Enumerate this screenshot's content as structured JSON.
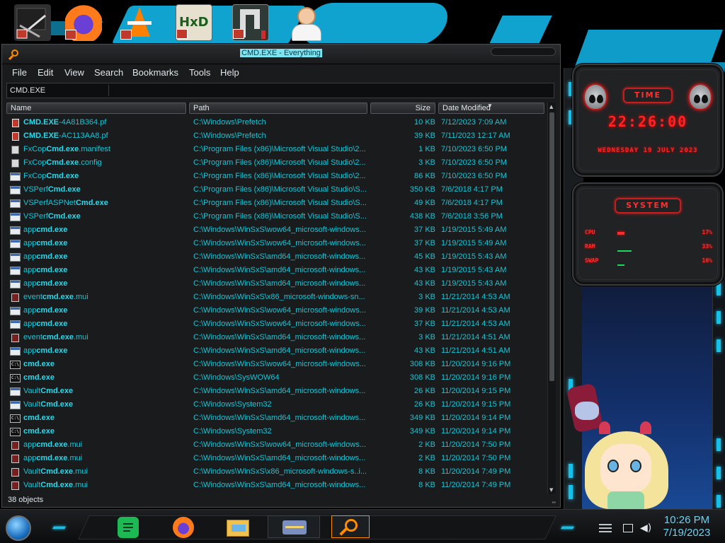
{
  "desktop": {
    "icons": [
      {
        "name": "Manage tools",
        "icon": "tools-icon"
      },
      {
        "name": "Firefox",
        "icon": "firefox-icon"
      },
      {
        "name": "VLC",
        "icon": "vlc-icon"
      },
      {
        "name": "HxD",
        "icon": "hxd-icon",
        "text": "HxD"
      },
      {
        "name": "Launcher",
        "icon": "launcher-icon"
      },
      {
        "name": "Doctor",
        "icon": "doctor-icon"
      }
    ]
  },
  "widgets": {
    "time": {
      "badge": "TIME",
      "clock": "22:26:00",
      "date": "WEDNESDAY 19 JULY 2023"
    },
    "system": {
      "badge": "SYSTEM",
      "stats": [
        {
          "label": "CPU",
          "value": "17%",
          "level": 0.17
        },
        {
          "label": "RAM",
          "value": "33%",
          "level": 0.33
        },
        {
          "label": "SWAP",
          "value": "16%",
          "level": 0.16
        }
      ]
    }
  },
  "window": {
    "title": "CMD.EXE - Everything",
    "menu": [
      "File",
      "Edit",
      "View",
      "Search",
      "Bookmarks",
      "Tools",
      "Help"
    ],
    "search": {
      "value": "CMD.EXE",
      "placeholder": ""
    },
    "columns": {
      "name": "Name",
      "path": "Path",
      "size": "Size",
      "date": "Date Modified"
    },
    "rows": [
      {
        "icon": "pf",
        "pre": "",
        "match": "CMD.EXE",
        "post": "-4A81B364.pf",
        "path": "C:\\Windows\\Prefetch",
        "size": "10 KB",
        "date": "7/12/2023 7:09 AM"
      },
      {
        "icon": "pf",
        "pre": "",
        "match": "CMD.EXE",
        "post": "-AC113AA8.pf",
        "path": "C:\\Windows\\Prefetch",
        "size": "39 KB",
        "date": "7/11/2023 12:17 AM"
      },
      {
        "icon": "doc",
        "pre": "FxCop",
        "match": "Cmd.exe",
        "post": ".manifest",
        "path": "C:\\Program Files (x86)\\Microsoft Visual Studio\\2...",
        "size": "1 KB",
        "date": "7/10/2023 6:50 PM"
      },
      {
        "icon": "doc",
        "pre": "FxCop",
        "match": "Cmd.exe",
        "post": ".config",
        "path": "C:\\Program Files (x86)\\Microsoft Visual Studio\\2...",
        "size": "3 KB",
        "date": "7/10/2023 6:50 PM"
      },
      {
        "icon": "exe",
        "pre": "FxCop",
        "match": "Cmd.exe",
        "post": "",
        "path": "C:\\Program Files (x86)\\Microsoft Visual Studio\\2...",
        "size": "86 KB",
        "date": "7/10/2023 6:50 PM"
      },
      {
        "icon": "exe",
        "pre": "VSPerf",
        "match": "Cmd.exe",
        "post": "",
        "path": "C:\\Program Files (x86)\\Microsoft Visual Studio\\S...",
        "size": "350 KB",
        "date": "7/6/2018 4:17 PM"
      },
      {
        "icon": "exe",
        "pre": "VSPerfASPNet",
        "match": "Cmd.exe",
        "post": "",
        "path": "C:\\Program Files (x86)\\Microsoft Visual Studio\\S...",
        "size": "49 KB",
        "date": "7/6/2018 4:17 PM"
      },
      {
        "icon": "exe",
        "pre": "VSPerf",
        "match": "Cmd.exe",
        "post": "",
        "path": "C:\\Program Files (x86)\\Microsoft Visual Studio\\S...",
        "size": "438 KB",
        "date": "7/6/2018 3:56 PM"
      },
      {
        "icon": "exe",
        "pre": "app",
        "match": "cmd.exe",
        "post": "",
        "path": "C:\\Windows\\WinSxS\\wow64_microsoft-windows...",
        "size": "37 KB",
        "date": "1/19/2015 5:49 AM"
      },
      {
        "icon": "exe",
        "pre": "app",
        "match": "cmd.exe",
        "post": "",
        "path": "C:\\Windows\\WinSxS\\wow64_microsoft-windows...",
        "size": "37 KB",
        "date": "1/19/2015 5:49 AM"
      },
      {
        "icon": "exe",
        "pre": "app",
        "match": "cmd.exe",
        "post": "",
        "path": "C:\\Windows\\WinSxS\\amd64_microsoft-windows...",
        "size": "45 KB",
        "date": "1/19/2015 5:43 AM"
      },
      {
        "icon": "exe",
        "pre": "app",
        "match": "cmd.exe",
        "post": "",
        "path": "C:\\Windows\\WinSxS\\amd64_microsoft-windows...",
        "size": "43 KB",
        "date": "1/19/2015 5:43 AM"
      },
      {
        "icon": "exe",
        "pre": "app",
        "match": "cmd.exe",
        "post": "",
        "path": "C:\\Windows\\WinSxS\\amd64_microsoft-windows...",
        "size": "43 KB",
        "date": "1/19/2015 5:43 AM"
      },
      {
        "icon": "mui",
        "pre": "event",
        "match": "cmd.exe",
        "post": ".mui",
        "path": "C:\\Windows\\WinSxS\\x86_microsoft-windows-sn...",
        "size": "3 KB",
        "date": "11/21/2014 4:53 AM"
      },
      {
        "icon": "exe",
        "pre": "app",
        "match": "cmd.exe",
        "post": "",
        "path": "C:\\Windows\\WinSxS\\wow64_microsoft-windows...",
        "size": "39 KB",
        "date": "11/21/2014 4:53 AM"
      },
      {
        "icon": "exe",
        "pre": "app",
        "match": "cmd.exe",
        "post": "",
        "path": "C:\\Windows\\WinSxS\\wow64_microsoft-windows...",
        "size": "37 KB",
        "date": "11/21/2014 4:53 AM"
      },
      {
        "icon": "mui",
        "pre": "event",
        "match": "cmd.exe",
        "post": ".mui",
        "path": "C:\\Windows\\WinSxS\\amd64_microsoft-windows...",
        "size": "3 KB",
        "date": "11/21/2014 4:51 AM"
      },
      {
        "icon": "exe",
        "pre": "app",
        "match": "cmd.exe",
        "post": "",
        "path": "C:\\Windows\\WinSxS\\amd64_microsoft-windows...",
        "size": "43 KB",
        "date": "11/21/2014 4:51 AM"
      },
      {
        "icon": "cmd",
        "pre": "",
        "match": "cmd.exe",
        "post": "",
        "path": "C:\\Windows\\WinSxS\\wow64_microsoft-windows...",
        "size": "308 KB",
        "date": "11/20/2014 9:16 PM"
      },
      {
        "icon": "cmd",
        "pre": "",
        "match": "cmd.exe",
        "post": "",
        "path": "C:\\Windows\\SysWOW64",
        "size": "308 KB",
        "date": "11/20/2014 9:16 PM"
      },
      {
        "icon": "exe",
        "pre": "Vault",
        "match": "Cmd.exe",
        "post": "",
        "path": "C:\\Windows\\WinSxS\\amd64_microsoft-windows...",
        "size": "26 KB",
        "date": "11/20/2014 9:15 PM"
      },
      {
        "icon": "exe",
        "pre": "Vault",
        "match": "Cmd.exe",
        "post": "",
        "path": "C:\\Windows\\System32",
        "size": "26 KB",
        "date": "11/20/2014 9:15 PM"
      },
      {
        "icon": "cmd",
        "pre": "",
        "match": "cmd.exe",
        "post": "",
        "path": "C:\\Windows\\WinSxS\\amd64_microsoft-windows...",
        "size": "349 KB",
        "date": "11/20/2014 9:14 PM"
      },
      {
        "icon": "cmd",
        "pre": "",
        "match": "cmd.exe",
        "post": "",
        "path": "C:\\Windows\\System32",
        "size": "349 KB",
        "date": "11/20/2014 9:14 PM"
      },
      {
        "icon": "mui",
        "pre": "app",
        "match": "cmd.exe",
        "post": ".mui",
        "path": "C:\\Windows\\WinSxS\\wow64_microsoft-windows...",
        "size": "2 KB",
        "date": "11/20/2014 7:50 PM"
      },
      {
        "icon": "mui",
        "pre": "app",
        "match": "cmd.exe",
        "post": ".mui",
        "path": "C:\\Windows\\WinSxS\\amd64_microsoft-windows...",
        "size": "2 KB",
        "date": "11/20/2014 7:50 PM"
      },
      {
        "icon": "mui",
        "pre": "Vault",
        "match": "Cmd.exe",
        "post": ".mui",
        "path": "C:\\Windows\\WinSxS\\x86_microsoft-windows-s..i...",
        "size": "8 KB",
        "date": "11/20/2014 7:49 PM"
      },
      {
        "icon": "mui",
        "pre": "Vault",
        "match": "Cmd.exe",
        "post": ".mui",
        "path": "C:\\Windows\\WinSxS\\amd64_microsoft-windows...",
        "size": "8 KB",
        "date": "11/20/2014 7:49 PM"
      }
    ],
    "status": "38 objects"
  },
  "taskbar": {
    "apps": [
      {
        "name": "Spotify",
        "icon": "spotify-icon"
      },
      {
        "name": "Firefox",
        "icon": "firefox-icon"
      },
      {
        "name": "File Explorer",
        "icon": "folder-icon"
      },
      {
        "name": "Card app",
        "icon": "card-icon"
      },
      {
        "name": "Everything",
        "icon": "everything-search-icon"
      }
    ],
    "clock": {
      "time": "10:26 PM",
      "date": "7/19/2023"
    },
    "accent": "#17c0e8"
  },
  "colors": {
    "match_text": "#2bd9ea",
    "list_text": "#19c5d6",
    "widget_red": "#ff2323",
    "title_highlight": "#7ee4f0"
  }
}
